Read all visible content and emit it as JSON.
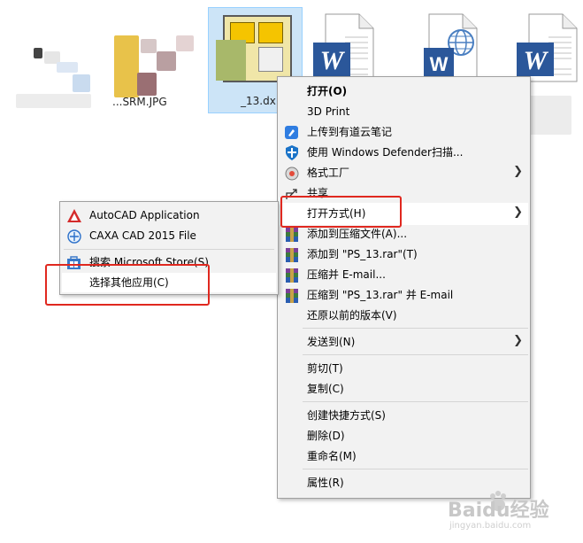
{
  "desktop": {
    "files": [
      {
        "label": "",
        "icon": "blurred-file-icon"
      },
      {
        "label": "...SRM.JPG",
        "icon": "jpg-file-icon"
      },
      {
        "label": "_13.dx",
        "icon": "dxf-file-icon"
      },
      {
        "label": "",
        "icon": "word-document-icon"
      },
      {
        "label": "",
        "icon": "word-web-document-icon"
      },
      {
        "label": "",
        "icon": "word-document-icon"
      }
    ]
  },
  "context_menu": {
    "items": [
      {
        "label": "打开(O)",
        "bold": true,
        "icon": ""
      },
      {
        "label": "3D Print",
        "icon": ""
      },
      {
        "label": "上传到有道云笔记",
        "icon": "youdao-note-icon"
      },
      {
        "label": "使用 Windows Defender扫描...",
        "icon": "windows-defender-icon"
      },
      {
        "label": "格式工厂",
        "icon": "format-factory-icon",
        "submenu": true
      },
      {
        "label": "共享",
        "icon": "share-icon"
      },
      {
        "label": "打开方式(H)",
        "icon": "",
        "submenu": true
      },
      {
        "label": "添加到压缩文件(A)...",
        "icon": "winrar-icon"
      },
      {
        "label": "添加到 \"PS_13.rar\"(T)",
        "icon": "winrar-icon"
      },
      {
        "label": "压缩并 E-mail...",
        "icon": "winrar-icon"
      },
      {
        "label": "压缩到 \"PS_13.rar\" 并 E-mail",
        "icon": "winrar-icon"
      },
      {
        "label": "还原以前的版本(V)",
        "icon": ""
      },
      {
        "label": "发送到(N)",
        "icon": "",
        "submenu": true
      },
      {
        "label": "剪切(T)",
        "icon": ""
      },
      {
        "label": "复制(C)",
        "icon": ""
      },
      {
        "label": "创建快捷方式(S)",
        "icon": ""
      },
      {
        "label": "删除(D)",
        "icon": ""
      },
      {
        "label": "重命名(M)",
        "icon": ""
      },
      {
        "label": "属性(R)",
        "icon": ""
      }
    ]
  },
  "open_with_submenu": {
    "items": [
      {
        "label": "AutoCAD Application",
        "icon": "autocad-icon"
      },
      {
        "label": "CAXA CAD 2015 File",
        "icon": "caxa-cad-icon"
      },
      {
        "label": "搜索 Microsoft Store(S)",
        "icon": "microsoft-store-icon"
      },
      {
        "label": "选择其他应用(C)",
        "icon": ""
      }
    ]
  },
  "watermark": {
    "text": "Baidu经验",
    "url": "jingyan.baidu.com"
  },
  "colors": {
    "highlight_box": "#e0281f",
    "selection_bg": "#cce4f7",
    "word_blue": "#2b579a",
    "winrar_purple": "#7b3f98"
  }
}
